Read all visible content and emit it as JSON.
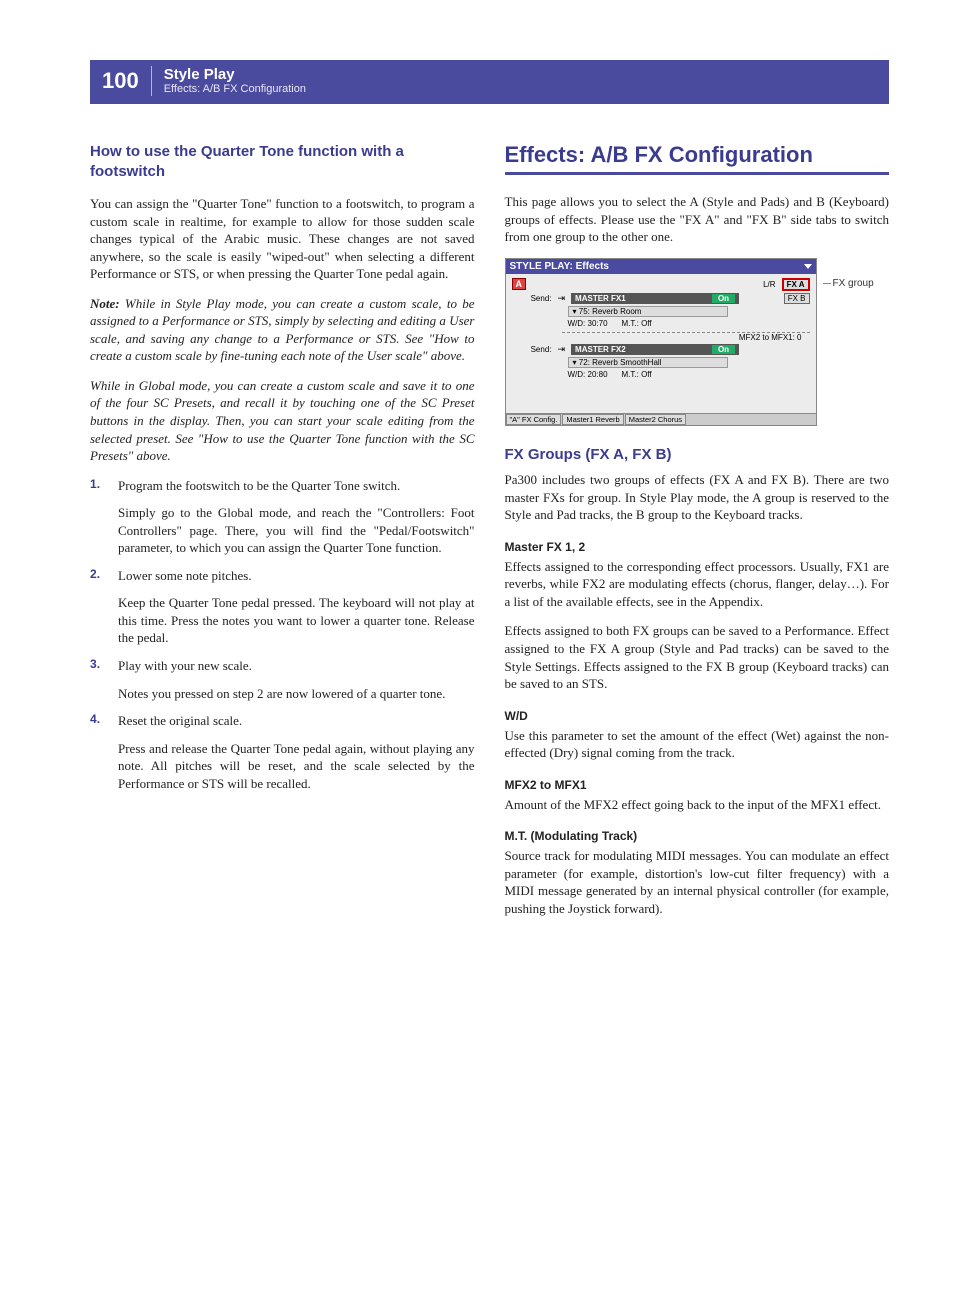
{
  "header": {
    "page_number": "100",
    "title": "Style Play",
    "subtitle": "Effects: A/B FX Configuration"
  },
  "left": {
    "heading": "How to use the Quarter Tone function with a footswitch",
    "intro": "You can assign the \"Quarter Tone\" function to a footswitch, to program a custom scale in realtime, for example to allow for those sudden scale changes typical of the Arabic music. These changes are not saved anywhere, so the scale is easily \"wiped-out\" when selecting a different Performance or STS, or when pressing the Quarter Tone pedal again.",
    "note_label": "Note:",
    "note1": " While in Style Play mode, you can create a custom scale, to be assigned to a Performance or STS, simply by selecting and editing a User scale, and saving any change to a Performance or STS. See \"How to create a custom scale by fine-tuning each note of the User scale\" above.",
    "note2": "While in Global mode, you can create a custom scale and save it to one of the four SC Presets, and recall it by touching one of the SC Preset buttons in the display. Then, you can start your scale editing from the selected preset. See \"How to use the Quarter Tone function with the SC Presets\" above.",
    "steps": [
      {
        "lead": "Program the footswitch to be the Quarter Tone switch.",
        "body": "Simply go to the Global mode, and reach the \"Controllers: Foot Controllers\" page. There, you will find the \"Pedal/Footswitch\" parameter, to which you can assign the Quarter Tone function."
      },
      {
        "lead": "Lower some note pitches.",
        "body": "Keep the Quarter Tone pedal pressed. The keyboard will not play at this time. Press the notes you want to lower a quarter tone. Release the pedal."
      },
      {
        "lead": "Play with your new scale.",
        "body": "Notes you pressed on step 2 are now lowered of a quarter tone."
      },
      {
        "lead": "Reset the original scale.",
        "body": "Press and release the Quarter Tone pedal again, without playing any note. All pitches will be reset, and the scale selected by the Performance or STS will be recalled."
      }
    ]
  },
  "right": {
    "heading": "Effects: A/B FX Configuration",
    "intro": "This page allows you to select the A (Style and Pads) and B (Keyboard) groups of effects. Please use the \"FX A\" and \"FX B\" side tabs to switch from one group to the other one.",
    "screenshot": {
      "title": "STYLE PLAY: Effects",
      "a": "A",
      "lr": "L/R",
      "fxa": "FX A",
      "fxb": "FX B",
      "send": "Send:",
      "master1": "MASTER FX1",
      "master2": "MASTER FX2",
      "on": "On",
      "eff1": "▾ 75: Reverb Room",
      "eff2": "▾ 72: Reverb SmoothHall",
      "wd1": "W/D:   30:70",
      "wd2": "W/D:   20:80",
      "mt1": "M.T.:   Off",
      "mt2": "M.T.:   Off",
      "mfx": "MFX2 to MFX1:  0",
      "tabs": [
        "\"A\" FX Config.",
        "Master1 Reverb",
        "Master2 Chorus"
      ]
    },
    "side_label": "FX group",
    "fx_heading": "FX Groups (FX A, FX B)",
    "fx_intro": "Pa300 includes two groups of effects (FX A and FX B). There are two master FXs for group. In Style Play mode, the A group is reserved to the Style and Pad tracks, the B group to the Keyboard tracks.",
    "sections": [
      {
        "title": "Master FX 1, 2",
        "p1": "Effects assigned to the corresponding effect processors. Usually, FX1 are reverbs, while FX2 are modulating effects (chorus, flanger, delay…). For a list of the available effects, see in the Appendix.",
        "p2": "Effects assigned to both FX groups can be saved to a Performance. Effect assigned to the FX A group (Style and Pad tracks) can be saved to the Style Settings. Effects assigned to the FX B group (Keyboard tracks) can be saved to an STS."
      },
      {
        "title": "W/D",
        "p1": "Use this parameter to set the amount of the effect (Wet) against the non-effected (Dry) signal coming from the track."
      },
      {
        "title": "MFX2 to MFX1",
        "p1": "Amount of the MFX2 effect going back to the input of the MFX1 effect."
      },
      {
        "title": "M.T. (Modulating Track)",
        "p1": "Source track for modulating MIDI messages. You can modulate an effect parameter (for example, distortion's low-cut filter frequency) with a MIDI message generated by an internal physical controller (for example, pushing the Joystick forward)."
      }
    ]
  }
}
